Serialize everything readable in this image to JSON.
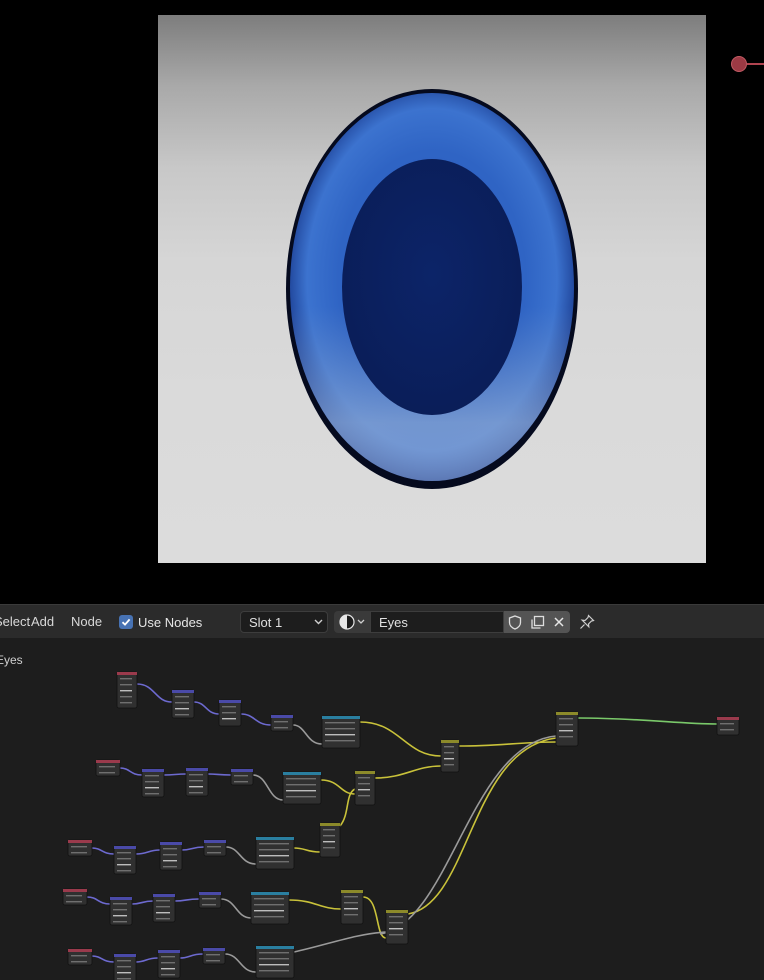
{
  "editor": {
    "menu": [
      "Select",
      "Add",
      "Node"
    ],
    "use_nodes_label": "Use Nodes",
    "use_nodes_checked": true,
    "slot_label": "Slot 1",
    "material_name": "Eyes",
    "breadcrumb": "Eyes"
  },
  "icons": {
    "material_browse": "material-sphere-icon",
    "fake_user": "shield-icon",
    "duplicate": "duplicate-icon",
    "unlink": "close-icon",
    "pin": "pin-icon"
  },
  "colors": {
    "iris_outer": "#0f2f7a",
    "iris_light": "#4d78c8",
    "pupil": "#0b2060",
    "wire_yellow": "#c9c23a",
    "wire_purple": "#6d6ad0",
    "wire_gray": "#9a9a9a",
    "wire_green": "#7ac96a"
  }
}
